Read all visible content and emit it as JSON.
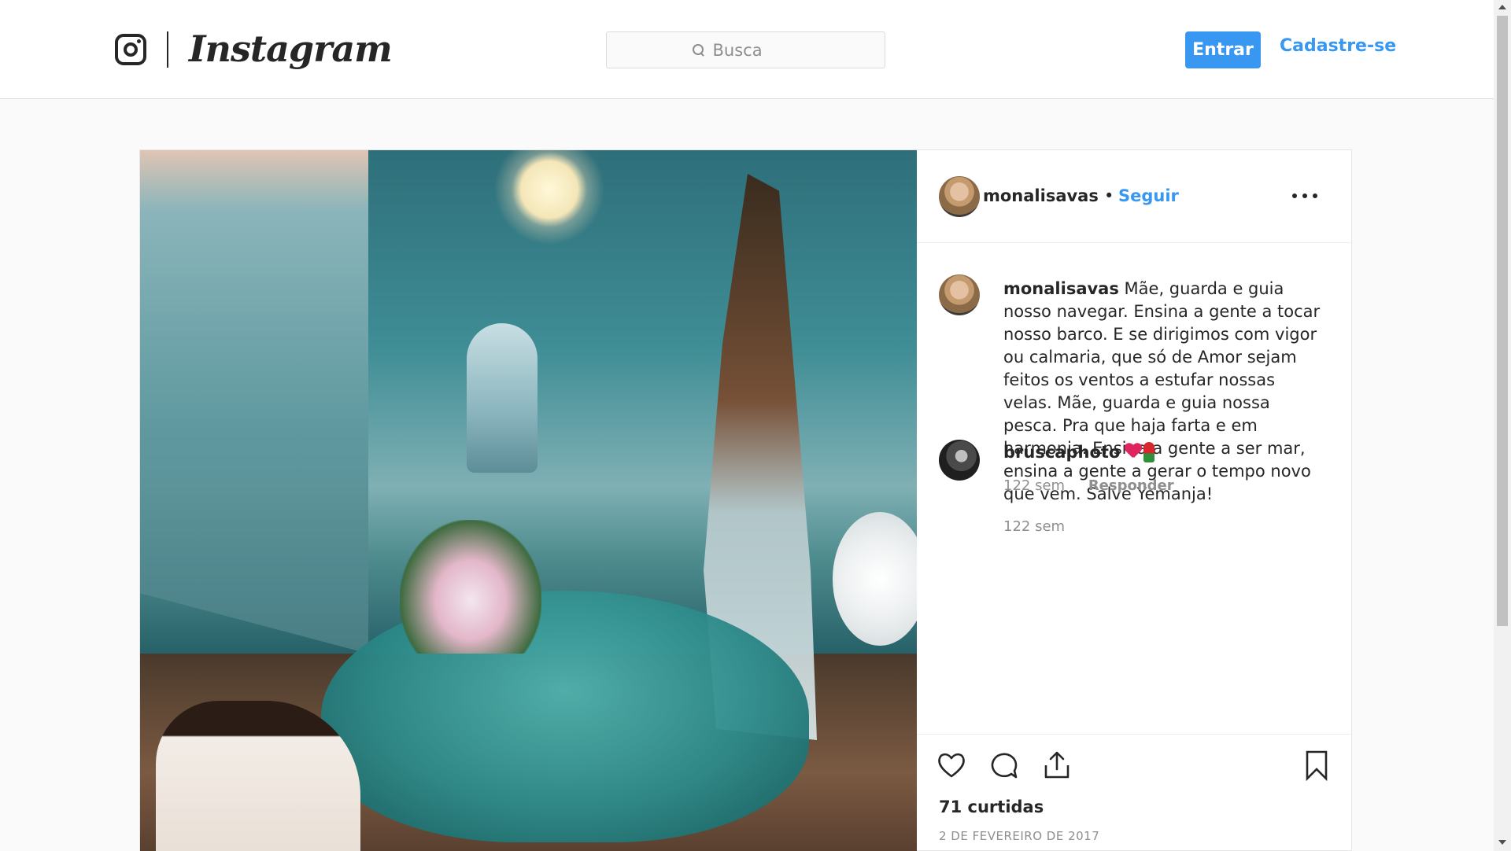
{
  "header": {
    "wordmark": "Instagram",
    "search_placeholder": "Busca",
    "login_label": "Entrar",
    "signup_label": "Cadastre-se",
    "brand_color": "#3897f0"
  },
  "post": {
    "author": "monalisavas",
    "separator": "•",
    "follow_label": "Seguir",
    "caption": {
      "user": "monalisavas",
      "text": "Mãe, guarda e guia nosso navegar. Ensina a gente a tocar nosso barco. E se dirigimos com vigor ou calmaria, que só de Amor sejam feitos os ventos a estufar nossas velas. Mãe, guarda e guia nossa pesca. Pra que haja farta e em harmonia. Ensina a gente a ser mar, ensina a gente a gerar o tempo novo que vem. Salve Yemanja!",
      "time": "122 sem"
    },
    "comments": [
      {
        "user": "bruscaphoto",
        "emojis": [
          "heart-emoji",
          "rose-emoji"
        ],
        "time": "122 sem",
        "reply_label": "Responder"
      }
    ],
    "likes": "71 curtidas",
    "date": "2 DE FEVEREIRO DE 2017",
    "icons": [
      "heart-icon",
      "comment-icon",
      "share-icon",
      "bookmark-icon",
      "more-options-icon",
      "instagram-logo-icon",
      "search-icon"
    ]
  }
}
